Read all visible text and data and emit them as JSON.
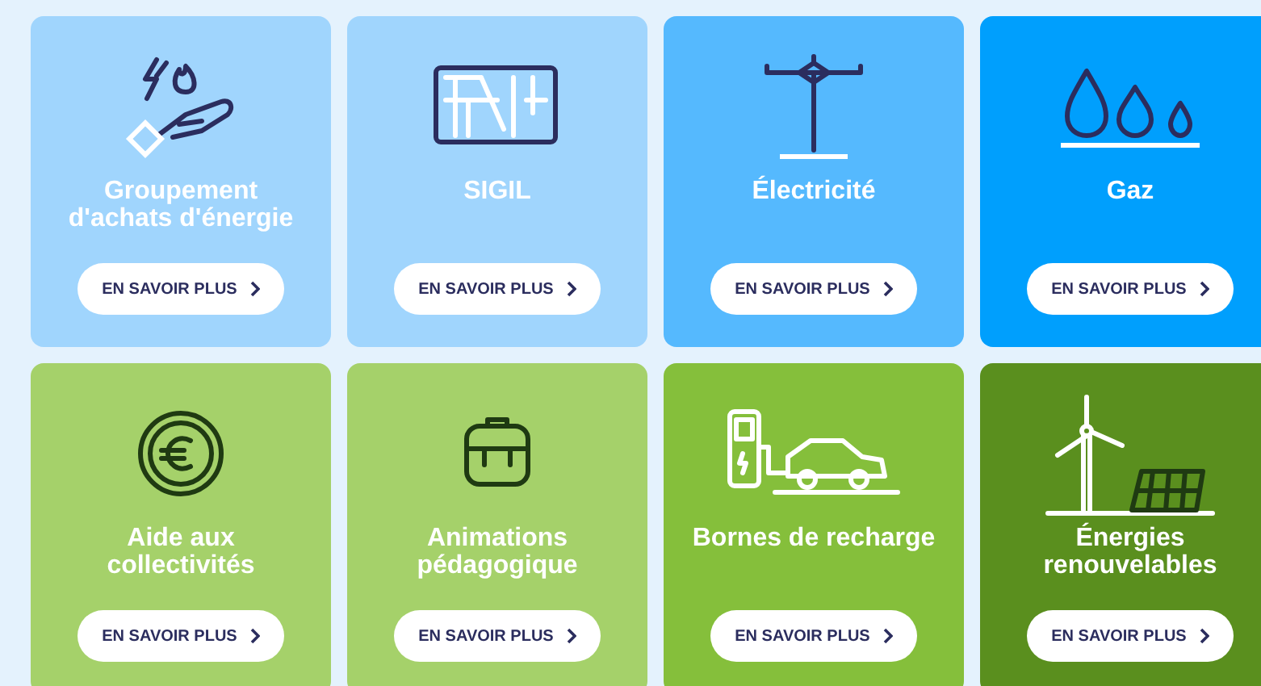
{
  "cards": [
    {
      "kind": "energy-hand",
      "title": "Groupement d'achats d'énergie",
      "color": "#a0d5fd",
      "button": "EN SAVOIR PLUS"
    },
    {
      "kind": "map",
      "title": "SIGIL",
      "color": "#a0d5fd",
      "button": "EN SAVOIR PLUS"
    },
    {
      "kind": "pylon",
      "title": "Électricité",
      "color": "#55b9fe",
      "button": "EN SAVOIR PLUS"
    },
    {
      "kind": "flames",
      "title": "Gaz",
      "color": "#009ffd",
      "button": "EN SAVOIR PLUS"
    },
    {
      "kind": "euro",
      "title": "Aide aux collectivités",
      "color": "#a5d16a",
      "button": "EN SAVOIR PLUS"
    },
    {
      "kind": "backpack",
      "title": "Animations pédagogique",
      "color": "#a5d16a",
      "button": "EN SAVOIR PLUS"
    },
    {
      "kind": "charger",
      "title": "Bornes de recharge",
      "color": "#85bf3b",
      "button": "EN SAVOIR PLUS"
    },
    {
      "kind": "renewables",
      "title": "Énergies renouvelables",
      "color": "#5a8f1e",
      "button": "EN SAVOIR PLUS"
    }
  ]
}
